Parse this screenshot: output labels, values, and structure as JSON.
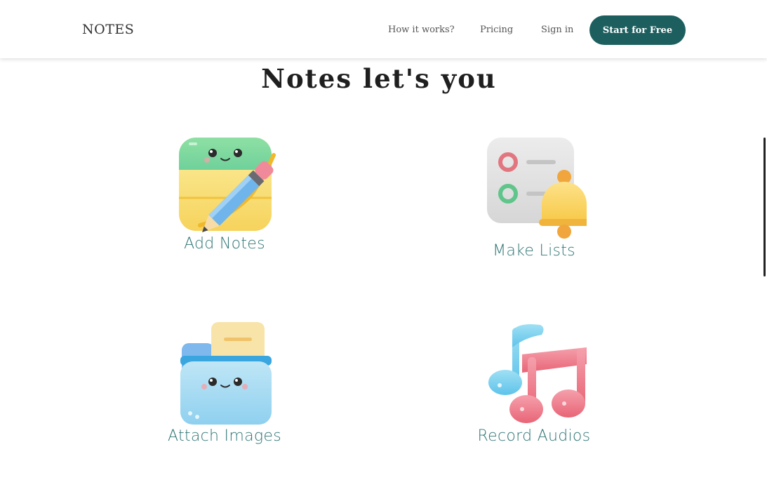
{
  "header": {
    "brand": "NOTES",
    "nav": {
      "how_it_works": "How it works?",
      "pricing": "Pricing",
      "sign_in": "Sign in"
    },
    "cta_label": "Start for Free"
  },
  "main": {
    "heading": "Notes let's you",
    "features": [
      {
        "label": "Add Notes",
        "icon": "notepad-pencil-icon"
      },
      {
        "label": "Make Lists",
        "icon": "checklist-bell-icon"
      },
      {
        "label": "Attach Images",
        "icon": "folder-images-icon"
      },
      {
        "label": "Record Audios",
        "icon": "music-notes-icon"
      }
    ]
  },
  "colors": {
    "accent": "#1d5f5f",
    "label": "#2f7474"
  }
}
